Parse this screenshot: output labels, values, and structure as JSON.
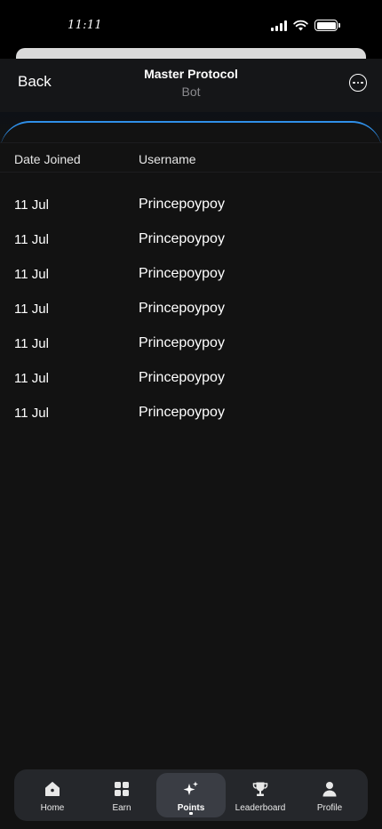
{
  "status_bar": {
    "time": "11:11"
  },
  "header": {
    "back_label": "Back",
    "title": "Master Protocol",
    "subtitle": "Bot"
  },
  "table": {
    "columns": [
      "Date Joined",
      "Username"
    ],
    "rows": [
      {
        "date": "11 Jul",
        "username": "Princepoypoy"
      },
      {
        "date": "11 Jul",
        "username": "Princepoypoy"
      },
      {
        "date": "11 Jul",
        "username": "Princepoypoy"
      },
      {
        "date": "11 Jul",
        "username": "Princepoypoy"
      },
      {
        "date": "11 Jul",
        "username": "Princepoypoy"
      },
      {
        "date": "11 Jul",
        "username": "Princepoypoy"
      },
      {
        "date": "11 Jul",
        "username": "Princepoypoy"
      }
    ]
  },
  "tab_bar": {
    "tabs": [
      {
        "label": "Home",
        "icon": "home-icon"
      },
      {
        "label": "Earn",
        "icon": "grid-icon"
      },
      {
        "label": "Points",
        "icon": "sparkle-icon",
        "active": true
      },
      {
        "label": "Leaderboard",
        "icon": "trophy-icon"
      },
      {
        "label": "Profile",
        "icon": "person-icon"
      }
    ]
  },
  "colors": {
    "accent_border": "#2f8fe8",
    "background": "#121212",
    "tab_bar": "#25272b",
    "tab_active": "#3a3d44"
  }
}
